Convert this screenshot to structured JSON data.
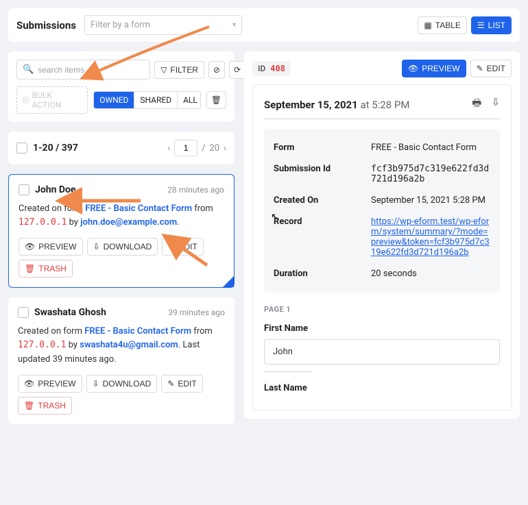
{
  "header": {
    "title": "Submissions",
    "form_filter_placeholder": "Filter by a form",
    "view_table": "TABLE",
    "view_list": "LIST"
  },
  "filters": {
    "search_placeholder": "search items",
    "filter_label": "FILTER",
    "bulk_action_label": "BULK ACTION",
    "segments": {
      "owned": "OWNED",
      "shared": "SHARED",
      "all": "ALL"
    }
  },
  "pagination": {
    "range": "1-20 / 397",
    "page_current": "1",
    "page_sep": "/",
    "page_total": "20"
  },
  "items": [
    {
      "name": "John Doe",
      "time_ago": "28 minutes ago",
      "created_prefix": "Created on form ",
      "form_name": "FREE - Basic Contact Form",
      "from_text": " from ",
      "ip": "127.0.0.1",
      "by_text": " by ",
      "email": "john.doe@example.com",
      "suffix": ".",
      "selected": true
    },
    {
      "name": "Swashata Ghosh",
      "time_ago": "39 minutes ago",
      "created_prefix": "Created on form ",
      "form_name": "FREE - Basic Contact Form",
      "from_text": " from ",
      "ip": "127.0.0.1",
      "by_text": " by ",
      "email": "swashata4u@gmail.com",
      "suffix": ". Last updated 39 minutes ago.",
      "selected": false
    }
  ],
  "item_actions": {
    "preview": "PREVIEW",
    "download": "DOWNLOAD",
    "edit": "EDIT",
    "trash": "TRASH"
  },
  "detail": {
    "id_label": "ID",
    "id_value": "408",
    "preview_btn": "PREVIEW",
    "edit_btn": "EDIT",
    "date_bold": "September 15, 2021",
    "date_light": " at 5:28 PM",
    "meta": {
      "form_label": "Form",
      "form_value": "FREE - Basic Contact Form",
      "sid_label": "Submission Id",
      "sid_value": "fcf3b975d7c319e622fd3d721d196a2b",
      "created_label": "Created On",
      "created_value": "September 15, 2021 5:28 PM",
      "record_label": "Record",
      "record_value": "https://wp-eform.test/wp-eform/system/summary/?mode=preview&token=fcf3b975d7c319e622fd3d721d196a2b",
      "duration_label": "Duration",
      "duration_value": "20 seconds"
    },
    "page_label": "PAGE 1",
    "fields": {
      "first_name_label": "First Name",
      "first_name_value": "John",
      "last_name_label": "Last Name"
    }
  },
  "colors": {
    "primary": "#1e63e9",
    "danger": "#e23c39",
    "arrow": "#ef8a4c"
  }
}
